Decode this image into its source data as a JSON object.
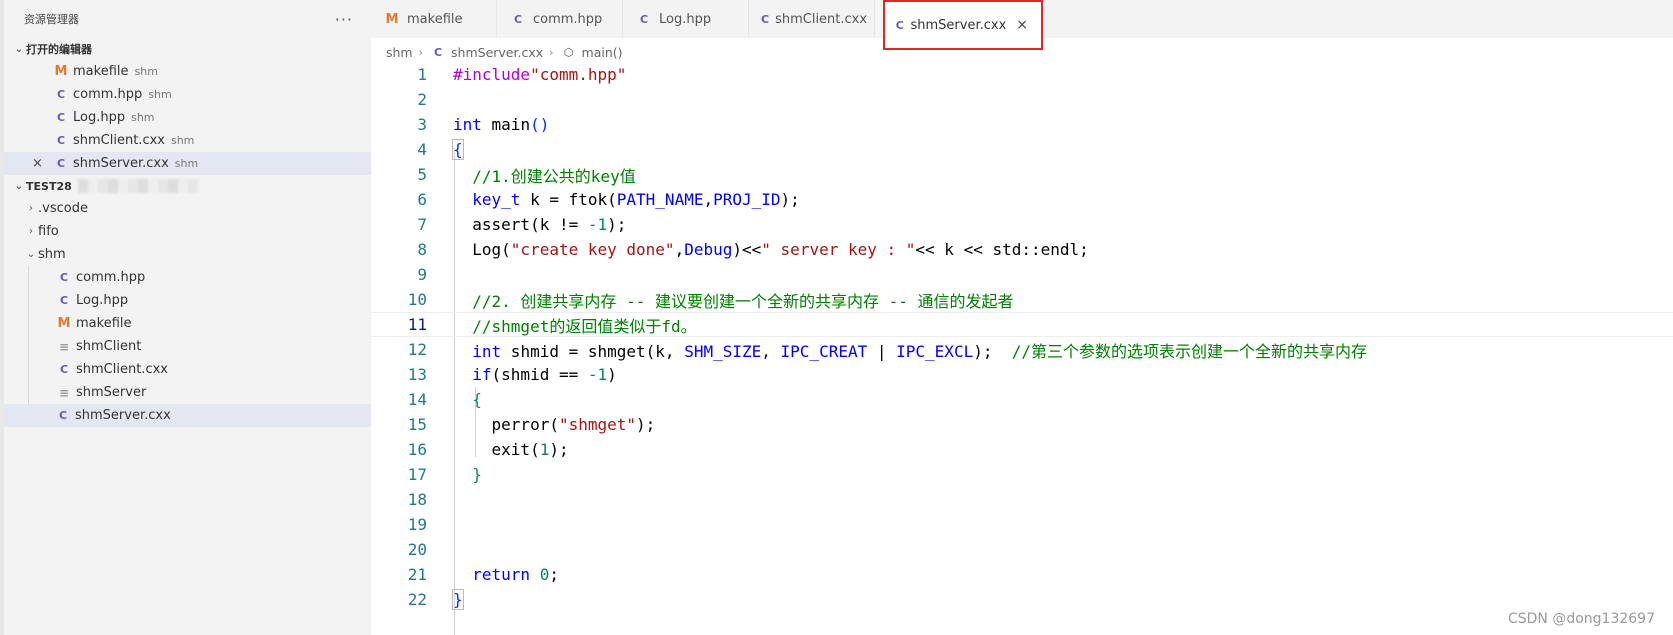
{
  "sidebar": {
    "header": "资源管理器",
    "more": "···",
    "open_editors_title": "打开的编辑器",
    "open_editors": [
      {
        "icon": "M",
        "name": "makefile",
        "dir": "shm"
      },
      {
        "icon": "C",
        "name": "comm.hpp",
        "dir": "shm"
      },
      {
        "icon": "C",
        "name": "Log.hpp",
        "dir": "shm"
      },
      {
        "icon": "C",
        "name": "shmClient.cxx",
        "dir": "shm"
      },
      {
        "icon": "C",
        "name": "shmServer.cxx",
        "dir": "shm",
        "close": "×"
      }
    ],
    "workspace_title": "TEST28",
    "tree": [
      {
        "name": ".vscode"
      },
      {
        "name": "fifo"
      },
      {
        "name": "shm"
      }
    ],
    "shm_children": [
      {
        "icon": "C",
        "name": "comm.hpp"
      },
      {
        "icon": "C",
        "name": "Log.hpp"
      },
      {
        "icon": "M",
        "name": "makefile"
      },
      {
        "icon": "≡",
        "name": "shmClient"
      },
      {
        "icon": "C",
        "name": "shmClient.cxx"
      },
      {
        "icon": "≡",
        "name": "shmServer"
      },
      {
        "icon": "C",
        "name": "shmServer.cxx"
      }
    ]
  },
  "tabs": [
    {
      "icon": "M",
      "label": "makefile"
    },
    {
      "icon": "C",
      "label": "comm.hpp"
    },
    {
      "icon": "C",
      "label": "Log.hpp"
    },
    {
      "icon": "C",
      "label": "shmClient.cxx"
    },
    {
      "icon": "C",
      "label": "shmServer.cxx",
      "close": "×"
    }
  ],
  "breadcrumb": {
    "folder": "shm",
    "file": "shmServer.cxx",
    "symbol": "main()"
  },
  "line_numbers": [
    "1",
    "2",
    "3",
    "4",
    "5",
    "6",
    "7",
    "8",
    "9",
    "10",
    "11",
    "12",
    "13",
    "14",
    "15",
    "16",
    "17",
    "18",
    "19",
    "20",
    "21",
    "22"
  ],
  "code": {
    "l1a": "#include",
    "l1b": "\"comm.hpp\"",
    "l3a": "int",
    "l3b": " main",
    "l3c": "()",
    "l4": "{",
    "l5": "//1.创建公共的key值",
    "l6a": "key_t",
    "l6b": " k = ftok(",
    "l6c": "PATH_NAME",
    "l6d": ",",
    "l6e": "PROJ_ID",
    "l6f": ");",
    "l7a": "assert(k != ",
    "l7b": "-1",
    "l7c": ");",
    "l8a": "Log(",
    "l8b": "\"create key done\"",
    "l8c": ",",
    "l8d": "Debug",
    "l8e": ")<<",
    "l8f": "\" server key : \"",
    "l8g": "<< k << std::endl;",
    "l10": "//2. 创建共享内存 -- 建议要创建一个全新的共享内存 -- 通信的发起者",
    "l11": "//shmget的返回值类似于fd。",
    "l12a": "int",
    "l12b": " shmid = shmget(k, ",
    "l12c": "SHM_SIZE",
    "l12d": ", ",
    "l12e": "IPC_CREAT",
    "l12f": " | ",
    "l12g": "IPC_EXCL",
    "l12h": ");  ",
    "l12i": "//第三个参数的选项表示创建一个全新的共享内存",
    "l13a": "if",
    "l13b": "(shmid == ",
    "l13c": "-1",
    "l13d": ")",
    "l14": "{",
    "l15a": "perror(",
    "l15b": "\"shmget\"",
    "l15c": ");",
    "l16a": "exit(",
    "l16b": "1",
    "l16c": ");",
    "l17": "}",
    "l21a": "return",
    "l21b": " ",
    "l21c": "0",
    "l21d": ";",
    "l22": "}"
  },
  "watermark": "CSDN @dong132697"
}
